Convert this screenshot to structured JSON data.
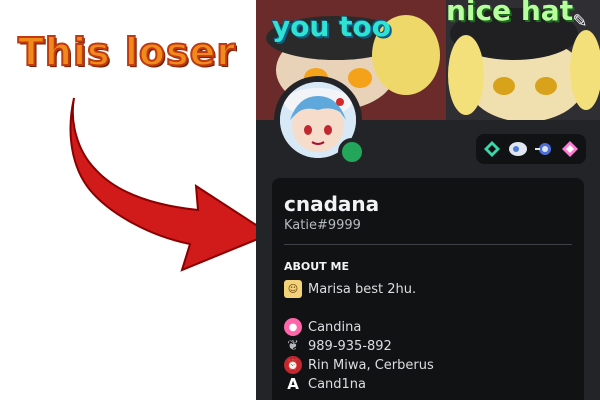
{
  "meme": {
    "caption": "This loser"
  },
  "banner": {
    "text_left": "you too",
    "text_right": "nice hat",
    "edit_icon": "pencil-icon"
  },
  "profile": {
    "username": "cnadana",
    "tag": "Katie#9999",
    "status": "online",
    "about_title": "ABOUT ME",
    "about_lines": [
      "Marisa best 2hu.",
      "Candina",
      "989-935-892",
      "Rin Miwa, Cerberus",
      "Cand1na"
    ]
  },
  "badges": [
    "hypesquad-icon",
    "nitro-icon",
    "boost-icon",
    "diamond-icon"
  ],
  "colors": {
    "card_bg": "#232428",
    "panel_bg": "#111214",
    "status_online": "#23a55a",
    "arrow_red": "#d11a1a",
    "caption_orange": "#f08a1a"
  }
}
